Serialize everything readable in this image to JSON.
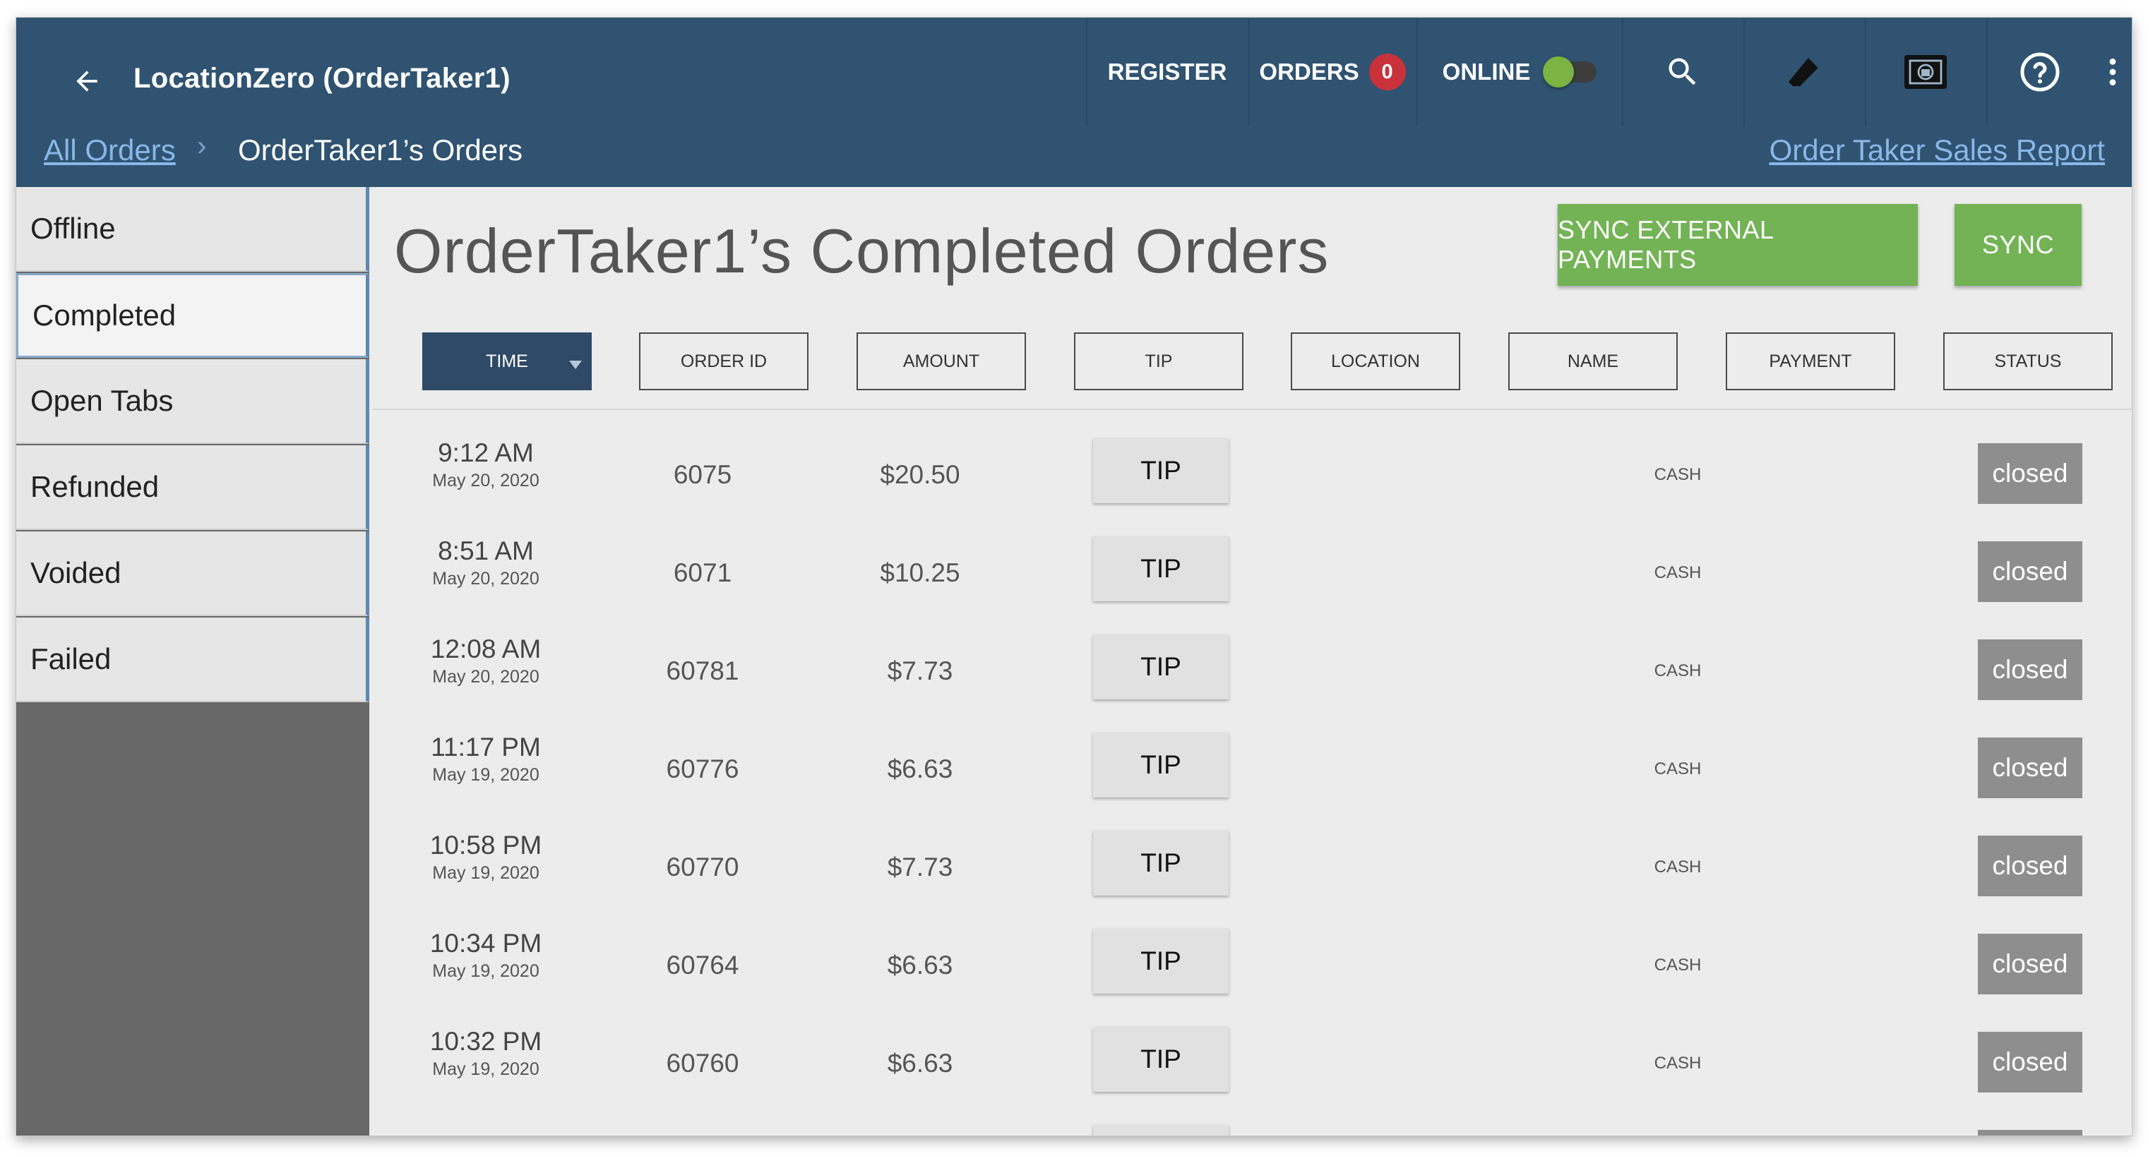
{
  "appbar": {
    "title": "LocationZero (OrderTaker1)",
    "register_label": "REGISTER",
    "orders_label": "ORDERS",
    "orders_count": "0",
    "online_label": "ONLINE",
    "online_on": true,
    "icons": [
      "back-arrow-icon",
      "search-icon",
      "eraser-icon",
      "cash-drawer-icon",
      "help-icon",
      "more-vert-icon"
    ]
  },
  "breadcrumb": {
    "all_orders": "All Orders",
    "separator": "›",
    "current": "OrderTaker1’s Orders",
    "report_link": "Order Taker Sales Report"
  },
  "sidebar": {
    "items": [
      {
        "label": "Offline"
      },
      {
        "label": "Completed"
      },
      {
        "label": "Open Tabs"
      },
      {
        "label": "Refunded"
      },
      {
        "label": "Voided"
      },
      {
        "label": "Failed"
      }
    ],
    "active": "Completed"
  },
  "main": {
    "title": "OrderTaker1’s Completed Orders",
    "sync_external_label": "SYNC EXTERNAL PAYMENTS",
    "sync_label": "SYNC",
    "columns": [
      "TIME",
      "ORDER ID",
      "AMOUNT",
      "TIP",
      "LOCATION",
      "NAME",
      "PAYMENT",
      "STATUS"
    ],
    "sorted_column": "TIME",
    "tip_button_label": "TIP",
    "rows": [
      {
        "time": "9:12 AM",
        "date": "May 20, 2020",
        "order_id": "6075",
        "amount": "$20.50",
        "name": "CASH",
        "status": "closed"
      },
      {
        "time": "8:51 AM",
        "date": "May 20, 2020",
        "order_id": "6071",
        "amount": "$10.25",
        "name": "CASH",
        "status": "closed"
      },
      {
        "time": "12:08 AM",
        "date": "May 20, 2020",
        "order_id": "60781",
        "amount": "$7.73",
        "name": "CASH",
        "status": "closed"
      },
      {
        "time": "11:17 PM",
        "date": "May 19, 2020",
        "order_id": "60776",
        "amount": "$6.63",
        "name": "CASH",
        "status": "closed"
      },
      {
        "time": "10:58 PM",
        "date": "May 19, 2020",
        "order_id": "60770",
        "amount": "$7.73",
        "name": "CASH",
        "status": "closed"
      },
      {
        "time": "10:34 PM",
        "date": "May 19, 2020",
        "order_id": "60764",
        "amount": "$6.63",
        "name": "CASH",
        "status": "closed"
      },
      {
        "time": "10:32 PM",
        "date": "May 19, 2020",
        "order_id": "60760",
        "amount": "$6.63",
        "name": "CASH",
        "status": "closed"
      }
    ]
  },
  "colors": {
    "appbar": "#2f5371",
    "accent_green": "#73b355",
    "badge_red": "#c9323a",
    "header_active": "#2f4a67",
    "status_closed": "#8e8e8e"
  }
}
